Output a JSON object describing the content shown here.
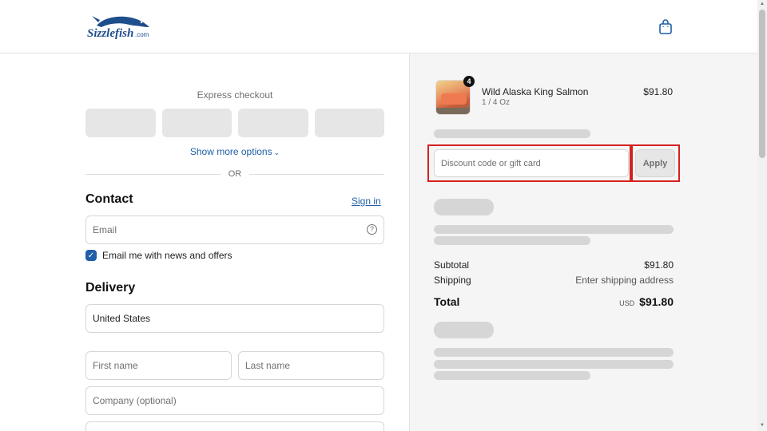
{
  "header": {
    "logo_text": "Sizzlefish",
    "logo_suffix": ".com",
    "cart_icon": "shopping-bag-icon"
  },
  "checkout": {
    "express_label": "Express checkout",
    "show_more": "Show more options",
    "or_label": "OR",
    "contact": {
      "title": "Contact",
      "sign_in": "Sign in",
      "email_placeholder": "Email",
      "newsletter_label": "Email me with news and offers",
      "newsletter_checked": true
    },
    "delivery": {
      "title": "Delivery",
      "country": "United States",
      "first_name_placeholder": "First name",
      "last_name_placeholder": "Last name",
      "company_placeholder": "Company (optional)"
    }
  },
  "summary": {
    "item": {
      "name": "Wild Alaska King Salmon",
      "variant": "1 / 4 Oz",
      "price": "$91.80",
      "quantity": "4"
    },
    "discount_placeholder": "Discount code or gift card",
    "apply_label": "Apply",
    "subtotal_label": "Subtotal",
    "subtotal_value": "$91.80",
    "shipping_label": "Shipping",
    "shipping_value": "Enter shipping address",
    "total_label": "Total",
    "total_currency": "USD",
    "total_value": "$91.80"
  },
  "colors": {
    "accent": "#1f5fa8",
    "highlight": "#d62020",
    "panel_bg": "#f5f5f5"
  }
}
